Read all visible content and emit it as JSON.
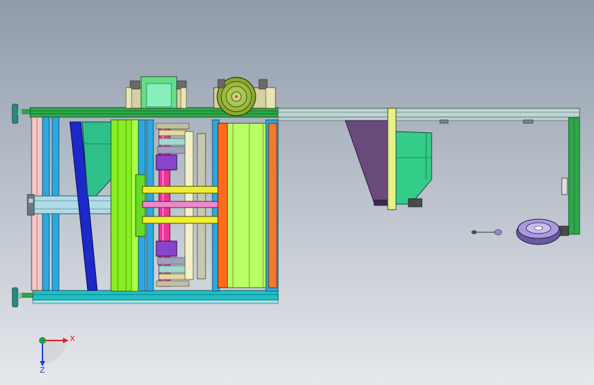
{
  "scene": {
    "background_top": "#8f9bab",
    "background_bottom": "#e6e8ec"
  },
  "triad": {
    "x_label": "X",
    "z_label": "Z",
    "x_color": "#e02020",
    "z_color": "#2040d0",
    "origin_color": "#18a048"
  },
  "parts": {
    "frame_color": "#2ea84a",
    "rail_color": "#c8dcdc",
    "motor_left_color": "#66dd88",
    "motor_right_color": "#8aaa30",
    "blue_belt_color": "#1c28c8",
    "green_plate_color": "#88ee22",
    "pink_roller_color": "#ee3399",
    "yellow_rod_color": "#eeee33",
    "purple_block_color": "#8844cc",
    "orange_plate_color": "#ff6a1a",
    "light_green_panel_color": "#bbff66",
    "hopper_color": "#6a4a7a",
    "chute_color": "#33cc88",
    "disc_color": "#aa99dd"
  }
}
